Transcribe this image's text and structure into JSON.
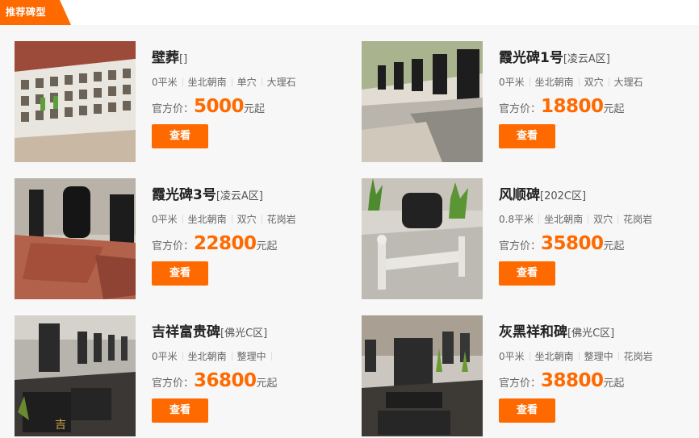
{
  "header": {
    "tab_label": "推荐碑型"
  },
  "products": [
    {
      "name": "壁葬",
      "area": "[]",
      "size": "0平米",
      "orientation": "坐北朝南",
      "type": "单穴",
      "material": "大理石",
      "price_label": "官方价：",
      "price": "5000",
      "price_unit": "元起",
      "button": "查看"
    },
    {
      "name": "霞光碑1号",
      "area": "[凌云A区]",
      "size": "0平米",
      "orientation": "坐北朝南",
      "type": "双穴",
      "material": "大理石",
      "price_label": "官方价：",
      "price": "18800",
      "price_unit": "元起",
      "button": "查看"
    },
    {
      "name": "霞光碑3号",
      "area": "[凌云A区]",
      "size": "0平米",
      "orientation": "坐北朝南",
      "type": "双穴",
      "material": "花岗岩",
      "price_label": "官方价：",
      "price": "22800",
      "price_unit": "元起",
      "button": "查看"
    },
    {
      "name": "风顺碑",
      "area": "[202C区]",
      "size": "0.8平米",
      "orientation": "坐北朝南",
      "type": "双穴",
      "material": "花岗岩",
      "price_label": "官方价：",
      "price": "35800",
      "price_unit": "元起",
      "button": "查看"
    },
    {
      "name": "吉祥富贵碑",
      "area": "[佛光C区]",
      "size": "0平米",
      "orientation": "坐北朝南",
      "type": "整理中",
      "material": "",
      "price_label": "官方价：",
      "price": "36800",
      "price_unit": "元起",
      "button": "查看"
    },
    {
      "name": "灰黑祥和碑",
      "area": "[佛光C区]",
      "size": "0平米",
      "orientation": "坐北朝南",
      "type": "整理中",
      "material": "花岗岩",
      "price_label": "官方价：",
      "price": "38800",
      "price_unit": "元起",
      "button": "查看"
    }
  ]
}
